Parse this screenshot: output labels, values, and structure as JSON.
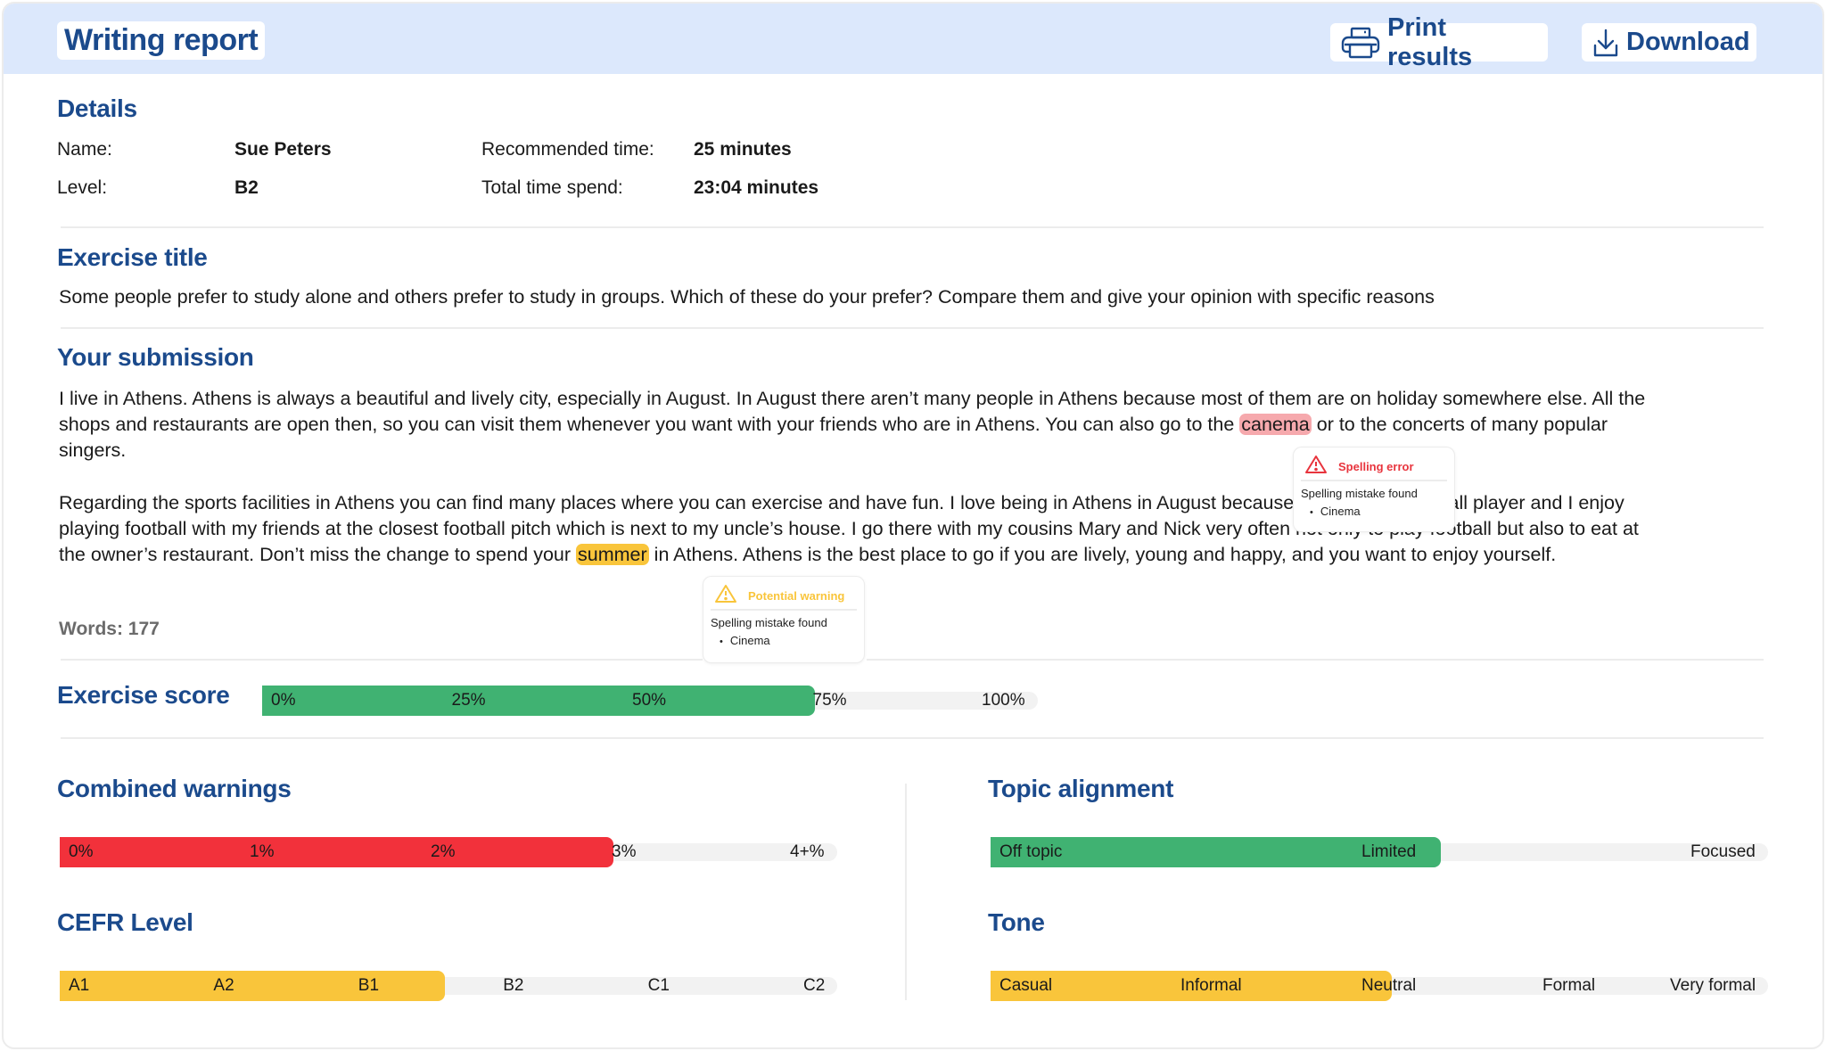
{
  "header": {
    "title": "Writing report",
    "print_label": "Print results",
    "download_label": "Download"
  },
  "details": {
    "heading": "Details",
    "name_label": "Name:",
    "name_value": "Sue Peters",
    "level_label": "Level:",
    "level_value": "B2",
    "recommended_label": "Recommended time:",
    "recommended_value": "25 minutes",
    "total_label": "Total time spend:",
    "total_value": "23:04 minutes"
  },
  "exercise": {
    "heading": "Exercise title",
    "text": "Some people prefer to study alone and others prefer to study in groups. Which of these do your prefer? Compare them and give your opinion with specific reasons"
  },
  "submission": {
    "heading": "Your submission",
    "p1_before": "I live in Athens. Athens is always a beautiful and lively city, especially in August. In August there aren’t many people in Athens because most of them are on holiday somewhere else. All the shops and restaurants are open then, so you can visit them whenever you want with your friends who are in Athens. You can also go to the ",
    "p1_error_word": "canema",
    "p1_after": " or to the concerts of many popular singers.",
    "p2_before": "Regarding the sports facilities in Athens you can find many places where you can exercise and have fun. I love being in Athens in August because I am a good football player and I enjoy playing football with my friends at the closest football pitch which is next to my uncle’s house. I go there with my cousins Mary and Nick very often not only to play football but also to eat at the owner’s restaurant. Don’t miss the change to spend your ",
    "p2_warning_word": "summer",
    "p2_after": " in Athens. Athens is the best place to go if you are lively, young and happy, and you want to enjoy yourself.",
    "words_label": "Words: 177"
  },
  "tooltips": {
    "error": {
      "title": "Spelling error",
      "message": "Spelling mistake found",
      "suggestions": [
        "Cinema"
      ],
      "color": "#e8343d"
    },
    "warning": {
      "title": "Potential warning",
      "message": "Spelling mistake found",
      "suggestions": [
        "Cinema"
      ],
      "color": "#f9c53b"
    }
  },
  "colors": {
    "brand": "#1b4a8c",
    "header_bg": "#dce8fc",
    "green": "#40b272",
    "red": "#f2313b",
    "yellow": "#f9c53b",
    "track": "#f2f2f2"
  },
  "scores": {
    "exercise_score": {
      "heading": "Exercise score",
      "ticks": [
        "0%",
        "25%",
        "50%",
        "75%",
        "100%"
      ],
      "value_percent": 75,
      "color": "#40b272"
    },
    "combined_warnings": {
      "heading": "Combined warnings",
      "ticks": [
        "0%",
        "1%",
        "2%",
        "3%",
        "4+%"
      ],
      "value_percent": 3,
      "color": "#f2313b"
    },
    "cefr_level": {
      "heading": "CEFR Level",
      "ticks": [
        "A1",
        "A2",
        "B1",
        "B2",
        "C1",
        "C2"
      ],
      "value_level": "B1",
      "color": "#f9c53b"
    },
    "topic_alignment": {
      "heading": "Topic alignment",
      "ticks": [
        "Off topic",
        "Limited",
        "Focused"
      ],
      "value_level": "Limited",
      "color": "#40b272"
    },
    "tone": {
      "heading": "Tone",
      "ticks": [
        "Casual",
        "Informal",
        "Neutral",
        "Formal",
        "Very formal"
      ],
      "value_level": "Neutral",
      "color": "#f9c53b"
    }
  }
}
